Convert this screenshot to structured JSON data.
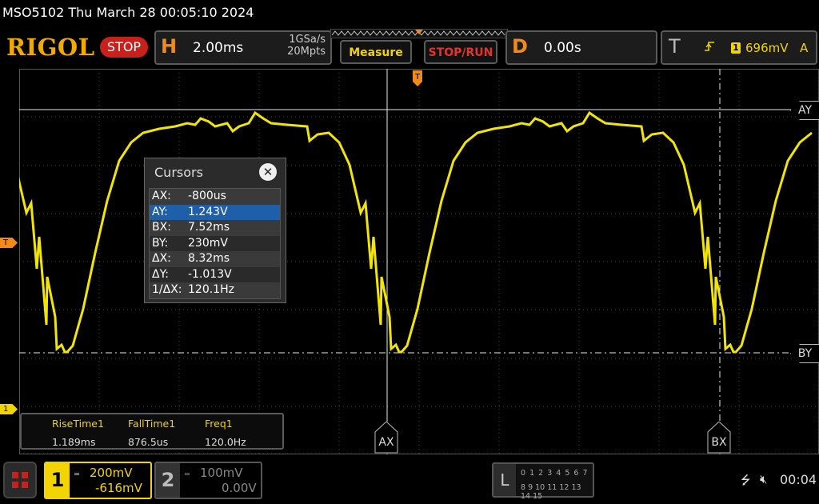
{
  "title_bar": {
    "text": "MSO5102  Thu March 28 00:05:10 2024"
  },
  "brand": {
    "logo": "RIGOL",
    "run_state": "STOP"
  },
  "horizontal": {
    "letter": "H",
    "timebase": "2.00ms",
    "sample_rate": "1GSa/s",
    "memory_depth": "20Mpts"
  },
  "buttons": {
    "measure": "Measure",
    "stop_run": "STOP/RUN"
  },
  "delay": {
    "letter": "D",
    "value": "0.00s"
  },
  "trigger": {
    "letter": "T",
    "edge_icon": "rising-edge-icon",
    "source": "1",
    "level": "696mV",
    "mode": "A"
  },
  "cursors": {
    "title": "Cursors",
    "rows": [
      {
        "key": "AX:",
        "value": "-800us"
      },
      {
        "key": "AY:",
        "value": "1.243V"
      },
      {
        "key": "BX:",
        "value": "7.52ms"
      },
      {
        "key": "BY:",
        "value": "230mV"
      },
      {
        "key": "ΔX:",
        "value": "8.32ms"
      },
      {
        "key": "ΔY:",
        "value": "-1.013V"
      },
      {
        "key": "1/ΔX:",
        "value": "120.1Hz"
      }
    ],
    "selected_index": 1,
    "tags": {
      "ax": "AX",
      "bx": "BX",
      "ay": "AY",
      "by": "BY"
    }
  },
  "measurements": [
    {
      "name": "RiseTime1",
      "value": "1.189ms"
    },
    {
      "name": "FallTime1",
      "value": "876.5us"
    },
    {
      "name": "Freq1",
      "value": "120.0Hz"
    }
  ],
  "markers": {
    "trigger_level": "T",
    "ch1_ground": "1"
  },
  "channels": {
    "ch1": {
      "number": "1",
      "scale": "200mV",
      "offset": "-616mV",
      "color": "#f2d400"
    },
    "ch2": {
      "number": "2",
      "scale": "100mV",
      "offset": "0.00V",
      "color": "#888888"
    }
  },
  "logic_analyzer": {
    "letter": "L",
    "row1": "0 1 2 3  4 5 6 7",
    "row2": "8 9 10 11 12 13 14 15"
  },
  "status": {
    "usb_icon": "usb-icon",
    "speaker_icon": "speaker-muted-icon",
    "clock": "00:04"
  },
  "colors": {
    "trace": "#f2d400",
    "accent": "#f28a1a",
    "stop": "#c8201a"
  }
}
